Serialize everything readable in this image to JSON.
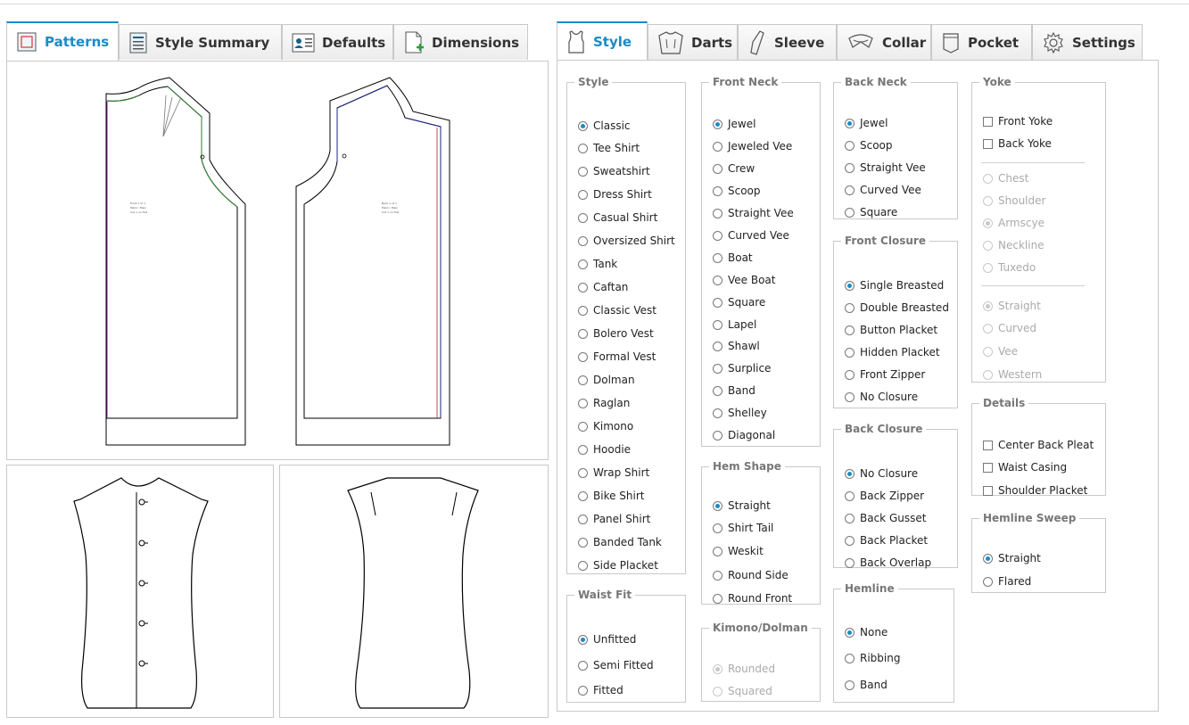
{
  "left_tabs": [
    {
      "label": "Patterns",
      "icon": "patterns-icon",
      "active": true
    },
    {
      "label": "Style Summary",
      "icon": "style-summary-icon",
      "active": false
    },
    {
      "label": "Defaults",
      "icon": "defaults-icon",
      "active": false
    },
    {
      "label": "Dimensions",
      "icon": "dimensions-icon",
      "active": false
    }
  ],
  "right_tabs": [
    {
      "label": "Style",
      "icon": "tank-top-icon",
      "active": true
    },
    {
      "label": "Darts",
      "icon": "darts-icon",
      "active": false
    },
    {
      "label": "Sleeve",
      "icon": "sleeve-icon",
      "active": false
    },
    {
      "label": "Collar",
      "icon": "collar-icon",
      "active": false
    },
    {
      "label": "Pocket",
      "icon": "pocket-icon",
      "active": false
    },
    {
      "label": "Settings",
      "icon": "gear-icon",
      "active": false
    }
  ],
  "groups": {
    "style": {
      "legend": "Style",
      "selected": "Classic",
      "options": [
        "Classic",
        "Tee Shirt",
        "Sweatshirt",
        "Dress Shirt",
        "Casual Shirt",
        "Oversized Shirt",
        "Tank",
        "Caftan",
        "Classic Vest",
        "Bolero Vest",
        "Formal Vest",
        "Dolman",
        "Raglan",
        "Kimono",
        "Hoodie",
        "Wrap Shirt",
        "Bike Shirt",
        "Panel Shirt",
        "Banded Tank",
        "Side Placket"
      ]
    },
    "waist_fit": {
      "legend": "Waist Fit",
      "selected": "Unfitted",
      "options": [
        "Unfitted",
        "Semi Fitted",
        "Fitted"
      ]
    },
    "front_neck": {
      "legend": "Front Neck",
      "selected": "Jewel",
      "options": [
        "Jewel",
        "Jeweled Vee",
        "Crew",
        "Scoop",
        "Straight Vee",
        "Curved Vee",
        "Boat",
        "Vee Boat",
        "Square",
        "Lapel",
        "Shawl",
        "Surplice",
        "Band",
        "Shelley",
        "Diagonal"
      ]
    },
    "hem_shape": {
      "legend": "Hem Shape",
      "selected": "Straight",
      "options": [
        "Straight",
        "Shirt Tail",
        "Weskit",
        "Round Side",
        "Round Front"
      ]
    },
    "kimono_dolman": {
      "legend": "Kimono/Dolman",
      "selected": "Rounded",
      "disabled": true,
      "options": [
        "Rounded",
        "Squared"
      ]
    },
    "back_neck": {
      "legend": "Back Neck",
      "selected": "Jewel",
      "options": [
        "Jewel",
        "Scoop",
        "Straight Vee",
        "Curved Vee",
        "Square"
      ]
    },
    "front_closure": {
      "legend": "Front Closure",
      "selected": "Single Breasted",
      "options": [
        "Single Breasted",
        "Double Breasted",
        "Button Placket",
        "Hidden Placket",
        "Front Zipper",
        "No Closure"
      ]
    },
    "back_closure": {
      "legend": "Back Closure",
      "selected": "No Closure",
      "options": [
        "No Closure",
        "Back Zipper",
        "Back Gusset",
        "Back Placket",
        "Back Overlap"
      ]
    },
    "hemline": {
      "legend": "Hemline",
      "selected": "None",
      "options": [
        "None",
        "Ribbing",
        "Band"
      ]
    },
    "yoke": {
      "legend": "Yoke",
      "checks": [
        "Front Yoke",
        "Back Yoke"
      ],
      "position_options": [
        "Chest",
        "Shoulder",
        "Armscye",
        "Neckline",
        "Tuxedo"
      ],
      "position_selected": "Armscye",
      "shape_options": [
        "Straight",
        "Curved",
        "Vee",
        "Western"
      ],
      "shape_selected": "Straight"
    },
    "details": {
      "legend": "Details",
      "checks": [
        "Center Back Pleat",
        "Waist Casing",
        "Shoulder Placket"
      ]
    },
    "hemline_sweep": {
      "legend": "Hemline Sweep",
      "selected": "Straight",
      "options": [
        "Straight",
        "Flared"
      ]
    }
  },
  "colors": {
    "accent": "#1a8bc7",
    "border": "#c9c9c9",
    "front_seam": "#2e7d32",
    "back_seam": "#1a237e",
    "center_line": "#7b1fa2"
  }
}
